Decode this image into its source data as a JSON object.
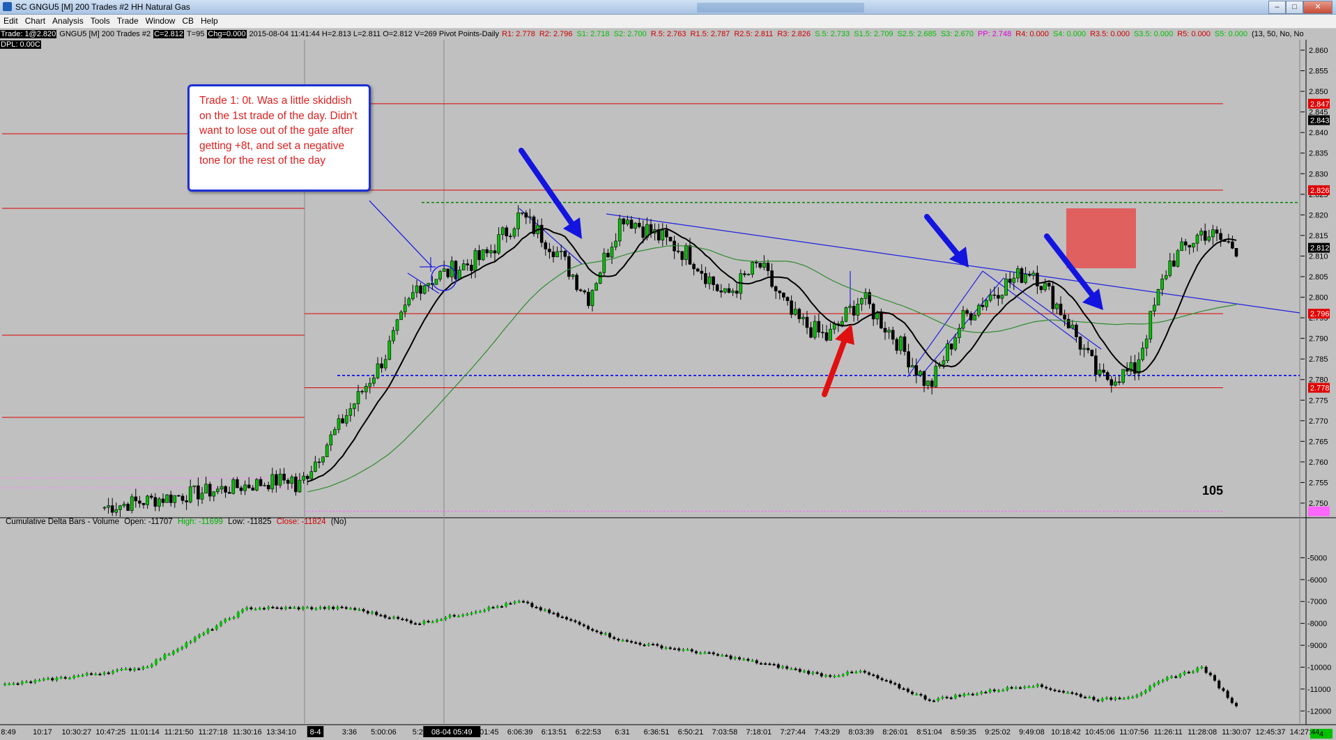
{
  "window": {
    "title": "SC GNGU5 [M]  200 Trades  #2  HH Natural Gas",
    "min_label": "–",
    "max_label": "□",
    "close_label": "✕"
  },
  "menu": [
    "Edit",
    "Chart",
    "Analysis",
    "Tools",
    "Trade",
    "Window",
    "CB",
    "Help"
  ],
  "header": {
    "trade_box": "Trade: 1@2.820",
    "symbol": "GNGU5 [M]  200 Trades  #2",
    "close_box": "C=2.812",
    "tick": "T=95",
    "chg_box": "Chg=0.000",
    "bar_info": "2015-08-04 11:41:44 H=2.813 L=2.811 O=2.812 V=269 Pivot Points-Daily",
    "pivots": [
      {
        "text": "R1: 2.778",
        "color": "#d00000"
      },
      {
        "text": "R2: 2.796",
        "color": "#d00000"
      },
      {
        "text": "S1: 2.718",
        "color": "#00c000"
      },
      {
        "text": "S2: 2.700",
        "color": "#00c000"
      },
      {
        "text": "R.5: 2.763",
        "color": "#d00000"
      },
      {
        "text": "R1.5: 2.787",
        "color": "#d00000"
      },
      {
        "text": "R2.5: 2.811",
        "color": "#d00000"
      },
      {
        "text": "R3: 2.826",
        "color": "#d00000"
      },
      {
        "text": "S.5: 2.733",
        "color": "#00c000"
      },
      {
        "text": "S1.5: 2.709",
        "color": "#00c000"
      },
      {
        "text": "S2.5: 2.685",
        "color": "#00c000"
      },
      {
        "text": "S3: 2.670",
        "color": "#00c000"
      },
      {
        "text": "PP: 2.748",
        "color": "#e000e0"
      },
      {
        "text": "R4: 0.000",
        "color": "#d00000"
      },
      {
        "text": "S4: 0.000",
        "color": "#00c000"
      },
      {
        "text": "R3.5: 0.000",
        "color": "#d00000"
      },
      {
        "text": "S3.5: 0.000",
        "color": "#00c000"
      },
      {
        "text": "R5: 0.000",
        "color": "#d00000"
      },
      {
        "text": "S5: 0.000",
        "color": "#00c000"
      },
      {
        "text": "(13, 50, No, No",
        "color": "#000000"
      }
    ],
    "dpl": "DPL: 0.00C"
  },
  "callout": {
    "text": "Trade 1: 0t.  Was a little skiddish on the 1st trade of the day. Didn't want to lose out of the gate after getting +8t, and set a negative tone for the rest of the day"
  },
  "label_105": "105",
  "price_axis": {
    "ticks": [
      "2.860",
      "2.855",
      "2.850",
      "2.845",
      "2.840",
      "2.835",
      "2.830",
      "2.825",
      "2.820",
      "2.815",
      "2.810",
      "2.805",
      "2.800",
      "2.795",
      "2.790",
      "2.785",
      "2.780",
      "2.775",
      "2.770",
      "2.765",
      "2.760",
      "2.755",
      "2.750"
    ],
    "tags": [
      {
        "text": "2.847",
        "color": "#e00000"
      },
      {
        "text": "2.843",
        "color": "#000000"
      },
      {
        "text": "2.826",
        "color": "#e00000"
      },
      {
        "text": "2.812",
        "color": "#000000"
      },
      {
        "text": "2.796",
        "color": "#e00000"
      },
      {
        "text": "2.778",
        "color": "#e00000"
      },
      {
        "text": "2.748",
        "color": "#ff66ff"
      }
    ]
  },
  "delta_panel": {
    "label": "Cumulative Delta Bars - Volume",
    "open": "Open: -11707",
    "high": "High: -11699",
    "low": "Low: -11825",
    "close": "Close: -11824",
    "flag": "(No)",
    "axis_ticks": [
      "-5000",
      "-6000",
      "-7000",
      "-8000",
      "-9000",
      "-10000",
      "-11000",
      "-12000"
    ],
    "corner": "4"
  },
  "time_axis": [
    "8:49",
    "10:17",
    "10:30:27",
    "10:47:25",
    "11:01:14",
    "11:21:50",
    "11:27:18",
    "11:30:16",
    "13:34:10",
    "8-4",
    "3:36",
    "5:00:06",
    "5:2",
    "08-04  05:49",
    "6:01:45",
    "6:06:39",
    "6:13:51",
    "6:22:53",
    "6:31",
    "6:36:51",
    "6:50:21",
    "7:03:58",
    "7:18:01",
    "7:27:44",
    "7:43:29",
    "8:03:39",
    "8:26:01",
    "8:51:04",
    "8:59:35",
    "9:25:02",
    "9:49:08",
    "10:18:42",
    "10:45:06",
    "11:07:56",
    "11:26:11",
    "11:28:08",
    "11:30:07",
    "12:45:37",
    "14:27:44"
  ],
  "chart_data": {
    "type": "candlestick",
    "symbol": "GNGU5",
    "price_range": [
      2.75,
      2.86
    ],
    "price_series_knots": [
      [
        "5:00:06",
        2.785
      ],
      [
        "5:2",
        2.803
      ],
      [
        "6:01:45",
        2.81
      ],
      [
        "6:06:39",
        2.82
      ],
      [
        "6:13:51",
        2.812
      ],
      [
        "6:22:53",
        2.8
      ],
      [
        "6:31",
        2.82
      ],
      [
        "6:50:21",
        2.81
      ],
      [
        "7:03:58",
        2.8
      ],
      [
        "7:18:01",
        2.808
      ],
      [
        "7:27:44",
        2.795
      ],
      [
        "7:43:29",
        2.79
      ],
      [
        "8:03:39",
        2.8
      ],
      [
        "8:26:01",
        2.79
      ],
      [
        "8:51:04",
        2.778
      ],
      [
        "8:59:35",
        2.795
      ],
      [
        "9:25:02",
        2.802
      ],
      [
        "9:49:08",
        2.807
      ],
      [
        "10:18:42",
        2.795
      ],
      [
        "10:45:06",
        2.78
      ],
      [
        "11:07:56",
        2.782
      ],
      [
        "11:26:11",
        2.808
      ],
      [
        "11:28:08",
        2.816
      ],
      [
        "11:30:07",
        2.812
      ]
    ],
    "horizontal_levels": [
      {
        "value": 2.847,
        "color": "#e00000"
      },
      {
        "value": 2.826,
        "color": "#e00000"
      },
      {
        "value": 2.823,
        "color": "#008000"
      },
      {
        "value": 2.796,
        "color": "#e00000"
      },
      {
        "value": 2.781,
        "color": "#0000ff"
      },
      {
        "value": 2.778,
        "color": "#e00000"
      },
      {
        "value": 2.748,
        "color": "#ff66ff"
      }
    ],
    "delta_range": [
      -12500,
      -4700
    ],
    "delta_series_knots": [
      [
        "8:49",
        -10800
      ],
      [
        "11:01:14",
        -10000
      ],
      [
        "11:30:16",
        -7300
      ],
      [
        "3:36",
        -7300
      ],
      [
        "5:2",
        -8000
      ],
      [
        "6:06:39",
        -7000
      ],
      [
        "6:31",
        -8800
      ],
      [
        "7:03:58",
        -9500
      ],
      [
        "7:43:29",
        -10400
      ],
      [
        "8:03:39",
        -10200
      ],
      [
        "8:51:04",
        -11500
      ],
      [
        "9:49:08",
        -10800
      ],
      [
        "10:45:06",
        -11500
      ],
      [
        "11:07:56",
        -11300
      ],
      [
        "11:26:11",
        -10500
      ],
      [
        "11:28:08",
        -10000
      ],
      [
        "11:30:07",
        -11824
      ]
    ]
  }
}
